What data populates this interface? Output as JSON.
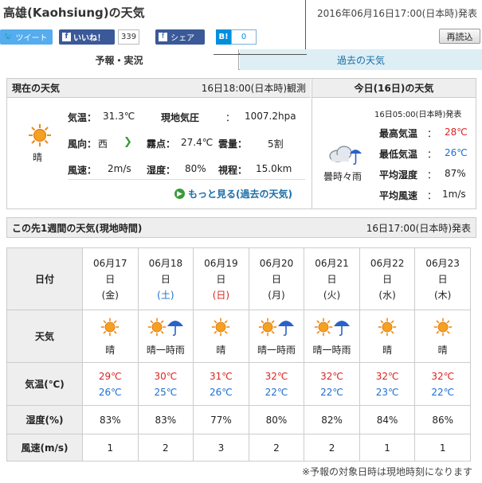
{
  "header": {
    "title": "高雄(Kaohsiung)の天気",
    "issued": "2016年06月16日17:00(日本時)発表",
    "reload_label": "再読込"
  },
  "social": {
    "tweet": "ツイート",
    "like": "いいね！",
    "like_count": "339",
    "share": "シェア",
    "hatena_b": "B!",
    "hatena_count": "0"
  },
  "tabs": [
    {
      "label": "予報・実況",
      "active": true
    },
    {
      "label": "過去の天気",
      "active": false
    }
  ],
  "current": {
    "header": "現在の天気",
    "observed": "16日18:00(日本時)観測",
    "weather": "晴",
    "icon": "sunny-icon",
    "temp_label": "気温：",
    "temp": "31.3℃",
    "pressure_label": "現地気圧",
    "pressure_colon": "：",
    "pressure": "1007.2hpa",
    "wind_dir_label": "風向：",
    "wind_dir": "西",
    "dew_label": "霧点：",
    "dew": "27.4℃",
    "cloud_label": "雲量：",
    "cloud": "5割",
    "wind_speed_label": "風速：",
    "wind_speed": "2m/s",
    "humidity_label": "湿度：",
    "humidity": "80%",
    "visibility_label": "視程：",
    "visibility": "15.0km",
    "more_link": "もっと見る(過去の天気)"
  },
  "today": {
    "header": "今日(16日)の天気",
    "issued": "16日05:00(日本時)発表",
    "weather": "曇時々雨",
    "icon": "cloud-rain-icon",
    "max_label": "最高気温",
    "max": "28℃",
    "min_label": "最低気温",
    "min": "26℃",
    "hum_label": "平均湿度",
    "hum": "87%",
    "wind_label": "平均風速",
    "wind": "1m/s",
    "colon": "："
  },
  "week": {
    "header": "この先1週間の天気(現地時間)",
    "issued": "16日17:00(日本時)発表",
    "row_labels": {
      "date": "日付",
      "weather": "天気",
      "temp": "気温(℃)",
      "humidity": "湿度(%)",
      "wind": "風速(m/s)"
    },
    "days": [
      {
        "date": "06月17",
        "d": "日",
        "dow": "(金)",
        "dow_color": "#222",
        "icon": "sunny",
        "weather": "晴",
        "max": "29℃",
        "min": "26℃",
        "hum": "83%",
        "wind": "1"
      },
      {
        "date": "06月18",
        "d": "日",
        "dow": "(土)",
        "dow_color": "#1a6fd0",
        "icon": "sun-rain",
        "weather": "晴一時雨",
        "max": "30℃",
        "min": "25℃",
        "hum": "83%",
        "wind": "2"
      },
      {
        "date": "06月19",
        "d": "日",
        "dow": "(日)",
        "dow_color": "#d22",
        "icon": "sunny",
        "weather": "晴",
        "max": "31℃",
        "min": "26℃",
        "hum": "77%",
        "wind": "3"
      },
      {
        "date": "06月20",
        "d": "日",
        "dow": "(月)",
        "dow_color": "#222",
        "icon": "sun-rain",
        "weather": "晴一時雨",
        "max": "32℃",
        "min": "22℃",
        "hum": "80%",
        "wind": "2"
      },
      {
        "date": "06月21",
        "d": "日",
        "dow": "(火)",
        "dow_color": "#222",
        "icon": "sun-rain",
        "weather": "晴一時雨",
        "max": "32℃",
        "min": "22℃",
        "hum": "82%",
        "wind": "2"
      },
      {
        "date": "06月22",
        "d": "日",
        "dow": "(水)",
        "dow_color": "#222",
        "icon": "sunny",
        "weather": "晴",
        "max": "32℃",
        "min": "23℃",
        "hum": "84%",
        "wind": "1"
      },
      {
        "date": "06月23",
        "d": "日",
        "dow": "(木)",
        "dow_color": "#222",
        "icon": "sunny",
        "weather": "晴",
        "max": "32℃",
        "min": "22℃",
        "hum": "86%",
        "wind": "1"
      }
    ]
  },
  "footnote": "※予報の対象日時は現地時刻になります"
}
